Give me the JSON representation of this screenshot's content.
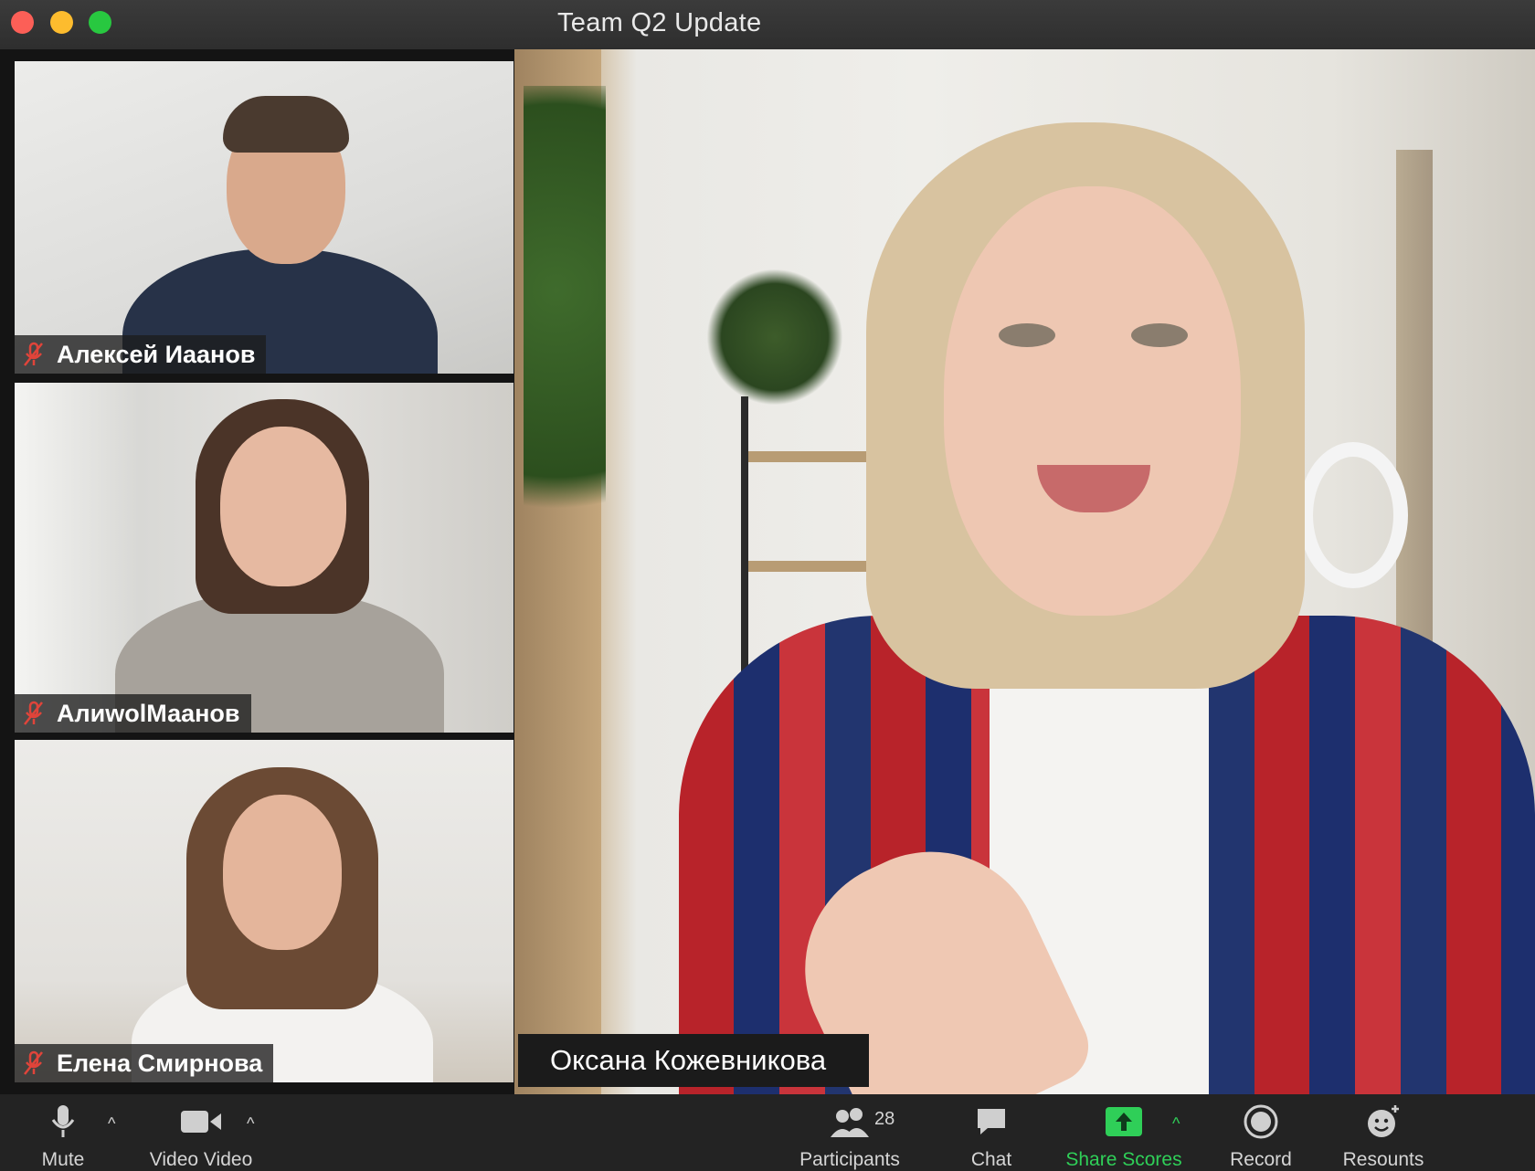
{
  "window": {
    "title": "Team Q2 Update"
  },
  "participants": [
    {
      "name": "Алексей Иаанов",
      "muted": true
    },
    {
      "name": "АлиwоlМаанов",
      "muted": true
    },
    {
      "name": "Елена Смирнова",
      "muted": true
    }
  ],
  "speaker": {
    "name": "Оксана Кожевникова"
  },
  "toolbar": {
    "mute_label": "Mute",
    "video_label": "Video Video",
    "participants_label": "Participants",
    "participants_count": "28",
    "chat_label": "Chat",
    "share_label": "Share Scores",
    "record_label": "Record",
    "resources_label": "Resounts"
  },
  "colors": {
    "accent_green": "#2fcf58",
    "mute_red": "#e0443a",
    "titlebar": "#333333"
  }
}
